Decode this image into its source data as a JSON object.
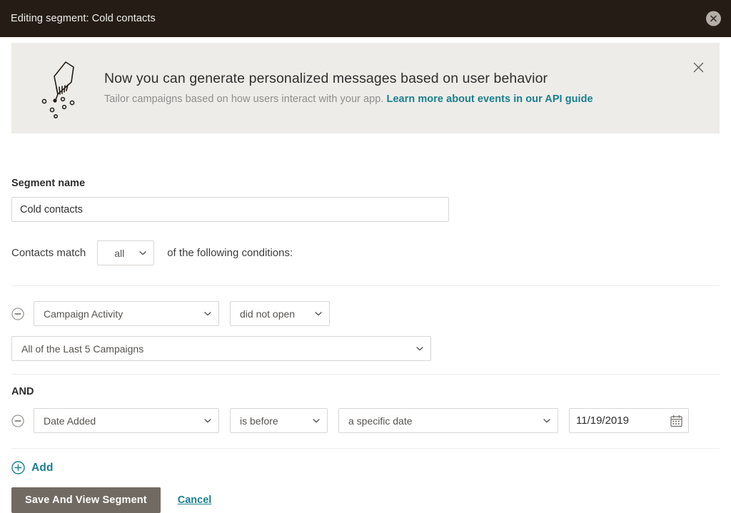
{
  "window": {
    "title": "Editing segment: Cold contacts",
    "close_icon": "close-circle-icon"
  },
  "banner": {
    "illustration": "hand-sprinkling-icon",
    "heading": "Now you can generate personalized messages based on user behavior",
    "subtext": "Tailor campaigns based on how users interact with your app.",
    "link_text": "Learn more about events in our API guide",
    "close_icon": "close-icon",
    "background": "#edece8",
    "link_color": "#1a7f8e"
  },
  "form": {
    "segment_name_label": "Segment name",
    "segment_name_value": "Cold contacts",
    "segment_name_placeholder": "Segment name",
    "match_prefix": "Contacts match",
    "match_value": "all",
    "match_suffix": "of the following conditions:",
    "and_label": "AND"
  },
  "conditions": [
    {
      "remove_icon": "minus-circle-icon",
      "field": "Campaign Activity",
      "operator": "did not open",
      "value": "All of the Last 5 Campaigns"
    },
    {
      "remove_icon": "minus-circle-icon",
      "field": "Date Added",
      "operator": "is before",
      "value": "a specific date",
      "date": "11/19/2019",
      "date_icon": "calendar-icon"
    }
  ],
  "actions": {
    "add_icon": "plus-circle-icon",
    "add_label": "Add",
    "save_label": "Save And View Segment",
    "cancel_label": "Cancel",
    "save_color": "#716a63",
    "accent_color": "#1a7f8e"
  }
}
